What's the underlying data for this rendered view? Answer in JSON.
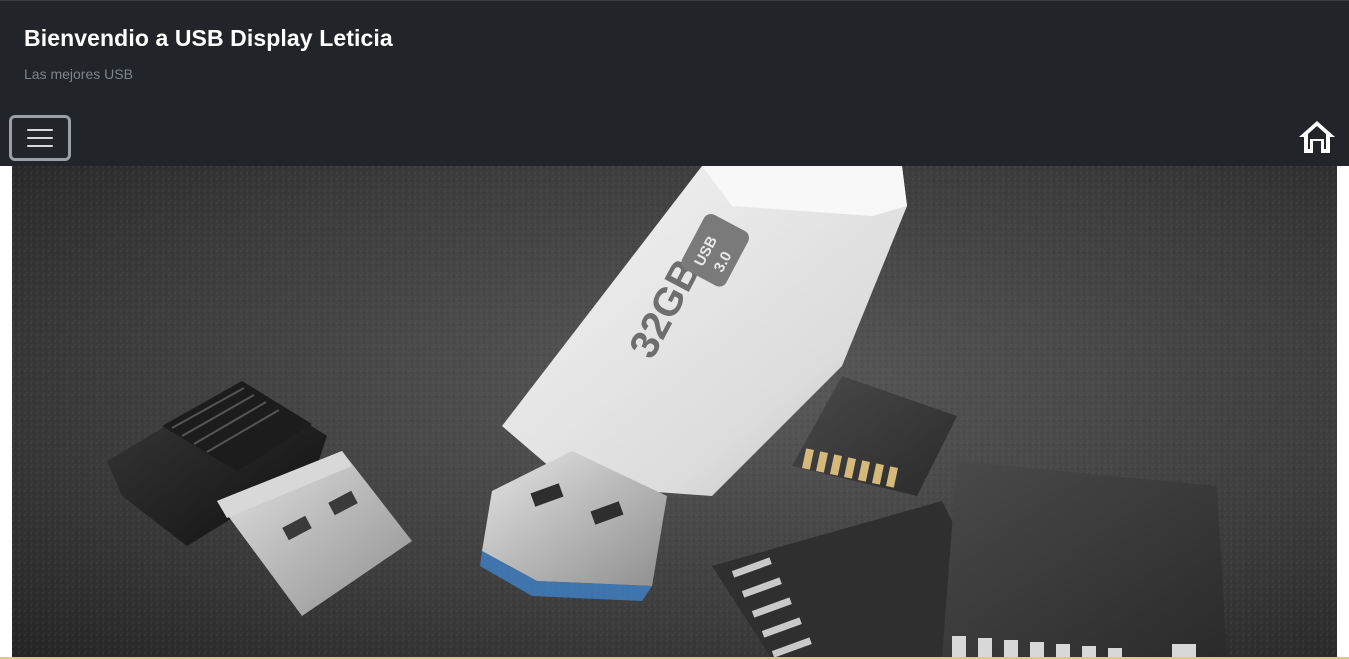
{
  "header": {
    "title": "Bienvendio a USB Display Leticia",
    "subtitle": "Las mejores USB",
    "background_color": "#212529"
  },
  "nav": {
    "menu_icon": "hamburger-menu-icon",
    "home_icon": "home-icon"
  },
  "hero": {
    "image_subject": "usb-drives-and-sd-cards-photo",
    "usb_capacity_label": "32GB",
    "usb_version_label_line1": "USB",
    "usb_version_label_line2": "3.0"
  }
}
